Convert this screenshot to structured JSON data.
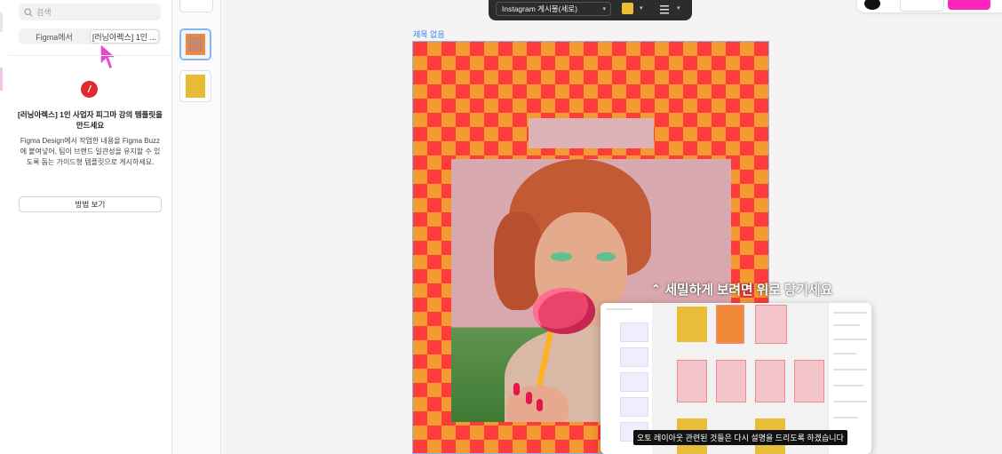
{
  "sidebar": {
    "search_placeholder": "검색",
    "tabs": [
      {
        "label": "Figma에서"
      },
      {
        "label": "[러닝아렉스] 1인 ..."
      }
    ],
    "template": {
      "title": "[러닝아렉스] 1인 사업자 피그마 강의 템플릿을 만드세요",
      "description": "Figma Design에서 작업한 내용을 Figma Buzz에 붙여넣어, 팀이 브랜드 일관성을 유지할 수 있도록 돕는 가이드형 템플릿으로 게시하세요.",
      "button_label": "방법 보기"
    }
  },
  "toolbar": {
    "format_label": "Instagram 게시물(세로)",
    "fill_color": "#E9BF3A"
  },
  "canvas": {
    "frame_label": "제목 없음"
  },
  "video": {
    "subtitle_top": "⌃ 세밀하게 보려면 위로 당기세요",
    "caption": "오토 레이아웃 관련된 것들은 다시 설명을 드리도록 하겠습니다"
  },
  "colors": {
    "accent_pink": "#FF24BD",
    "selection_blue": "#3B82F6",
    "checker_red": "#FF3B3B",
    "checker_orange": "#F39A30"
  }
}
